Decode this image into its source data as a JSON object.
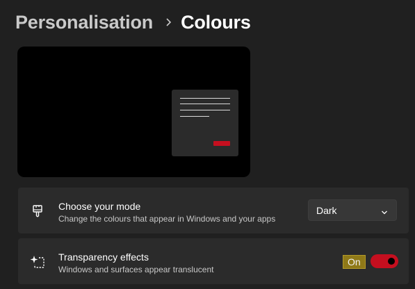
{
  "header": {
    "parent": "Personalisation",
    "separator_icon": "chevron-right-icon",
    "current": "Colours"
  },
  "preview": {
    "accent_color": "#c50f1f"
  },
  "mode_setting": {
    "icon": "paintbrush-icon",
    "title": "Choose your mode",
    "description": "Change the colours that appear in Windows and your apps",
    "selected_value": "Dark",
    "dropdown_icon": "chevron-down-icon"
  },
  "transparency_setting": {
    "icon": "transparency-sparkle-icon",
    "title": "Transparency effects",
    "description": "Windows and surfaces appear translucent",
    "state_label": "On",
    "toggle_on": true,
    "toggle_color": "#c50f1f"
  }
}
